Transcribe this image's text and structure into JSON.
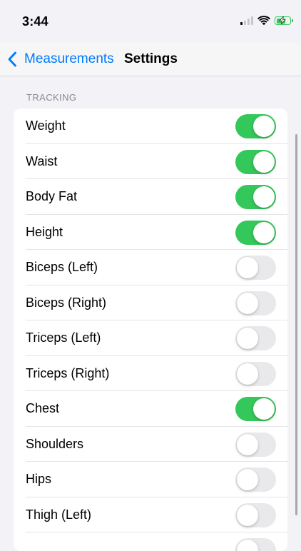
{
  "status_bar": {
    "time": "3:44",
    "icons": [
      "cellular-signal-icon",
      "wifi-icon",
      "battery-charging-icon"
    ],
    "battery_color": "#34c759"
  },
  "nav": {
    "back_label": "Measurements",
    "title": "Settings",
    "accent": "#007aff"
  },
  "section": {
    "header": "TRACKING"
  },
  "colors": {
    "toggle_on": "#34c759",
    "toggle_off": "#e9e9eb"
  },
  "items": [
    {
      "label": "Weight",
      "on": true
    },
    {
      "label": "Waist",
      "on": true
    },
    {
      "label": "Body Fat",
      "on": true
    },
    {
      "label": "Height",
      "on": true
    },
    {
      "label": "Biceps (Left)",
      "on": false
    },
    {
      "label": "Biceps (Right)",
      "on": false
    },
    {
      "label": "Triceps (Left)",
      "on": false
    },
    {
      "label": "Triceps (Right)",
      "on": false
    },
    {
      "label": "Chest",
      "on": true
    },
    {
      "label": "Shoulders",
      "on": false
    },
    {
      "label": "Hips",
      "on": false
    },
    {
      "label": "Thigh (Left)",
      "on": false
    },
    {
      "label": "",
      "on": false
    }
  ]
}
